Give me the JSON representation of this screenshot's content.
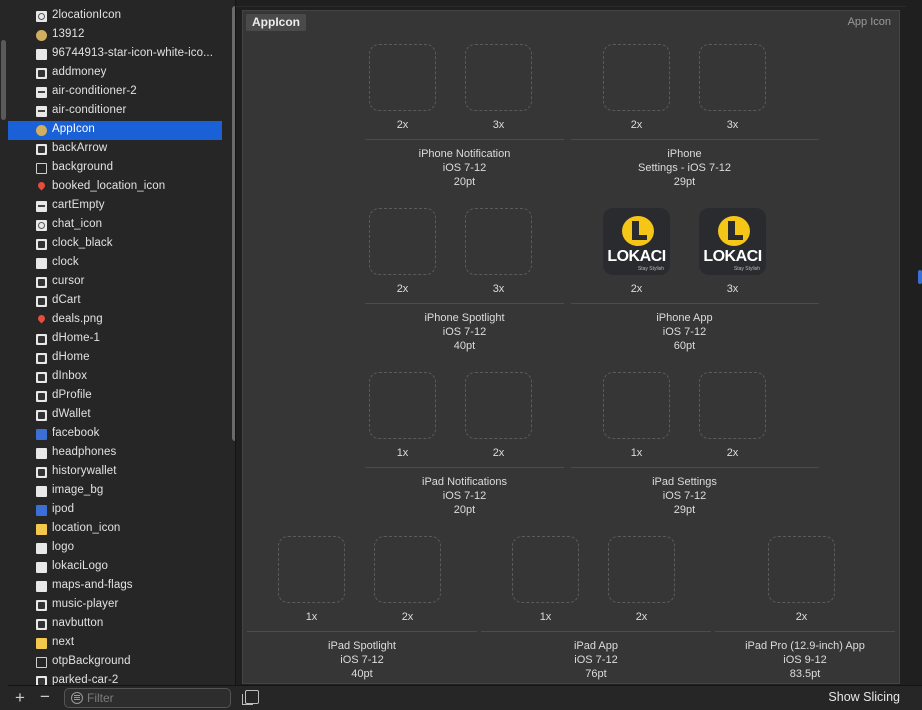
{
  "sidebar": {
    "items": [
      {
        "label": "2locationIcon",
        "icon": "image-icon",
        "style": "ring"
      },
      {
        "label": "13912",
        "icon": "image-icon",
        "style": "round"
      },
      {
        "label": "96744913-star-icon-white-ico...",
        "icon": "image-icon",
        "style": "plain"
      },
      {
        "label": "addmoney",
        "icon": "image-icon",
        "style": "dark"
      },
      {
        "label": "air-conditioner-2",
        "icon": "image-icon",
        "style": "line"
      },
      {
        "label": "air-conditioner",
        "icon": "image-icon",
        "style": "line"
      },
      {
        "label": "AppIcon",
        "icon": "app-icon-set-icon",
        "style": "round",
        "selected": true
      },
      {
        "label": "backArrow",
        "icon": "image-icon",
        "style": "dark"
      },
      {
        "label": "background",
        "icon": "image-icon",
        "style": "outline"
      },
      {
        "label": "booked_location_icon",
        "icon": "location-pin-icon",
        "style": "red"
      },
      {
        "label": "cartEmpty",
        "icon": "image-icon",
        "style": "line"
      },
      {
        "label": "chat_icon",
        "icon": "image-icon",
        "style": "ring"
      },
      {
        "label": "clock_black",
        "icon": "image-icon",
        "style": "dark"
      },
      {
        "label": "clock",
        "icon": "image-icon",
        "style": "plain"
      },
      {
        "label": "cursor",
        "icon": "image-icon",
        "style": "dark"
      },
      {
        "label": "dCart",
        "icon": "image-icon",
        "style": "dark"
      },
      {
        "label": "deals.png",
        "icon": "image-icon",
        "style": "red"
      },
      {
        "label": "dHome-1",
        "icon": "image-icon",
        "style": "dark"
      },
      {
        "label": "dHome",
        "icon": "image-icon",
        "style": "dark"
      },
      {
        "label": "dInbox",
        "icon": "image-icon",
        "style": "dark"
      },
      {
        "label": "dProfile",
        "icon": "image-icon",
        "style": "dark"
      },
      {
        "label": "dWallet",
        "icon": "image-icon",
        "style": "dark"
      },
      {
        "label": "facebook",
        "icon": "image-icon",
        "style": "blue"
      },
      {
        "label": "headphones",
        "icon": "image-icon",
        "style": "plain"
      },
      {
        "label": "historywallet",
        "icon": "image-icon",
        "style": "dark"
      },
      {
        "label": "image_bg",
        "icon": "image-icon",
        "style": "plain"
      },
      {
        "label": "ipod",
        "icon": "image-icon",
        "style": "blue"
      },
      {
        "label": "location_icon",
        "icon": "image-icon",
        "style": "yellow"
      },
      {
        "label": "logo",
        "icon": "image-icon",
        "style": "plain"
      },
      {
        "label": "lokaciLogo",
        "icon": "image-icon",
        "style": "plain"
      },
      {
        "label": "maps-and-flags",
        "icon": "image-icon",
        "style": "plain"
      },
      {
        "label": "music-player",
        "icon": "image-icon",
        "style": "dark"
      },
      {
        "label": "navbutton",
        "icon": "image-icon",
        "style": "dark"
      },
      {
        "label": "next",
        "icon": "image-icon",
        "style": "yellow"
      },
      {
        "label": "otpBackground",
        "icon": "image-icon",
        "style": "outline"
      },
      {
        "label": "parked-car-2",
        "icon": "image-icon",
        "style": "dark"
      }
    ]
  },
  "bottom_left": {
    "add": "+",
    "remove": "−",
    "filter_placeholder": "Filter"
  },
  "editor": {
    "set_name": "AppIcon",
    "set_type": "App Icon",
    "show_slicing": "Show Slicing",
    "groups": [
      {
        "name": "iPhone Notification",
        "line1": "iPhone Notification",
        "line2": "iOS 7-12",
        "line3": "20pt",
        "slots": [
          {
            "scale": "2x",
            "filled": false
          },
          {
            "scale": "3x",
            "filled": false
          }
        ]
      },
      {
        "name": "iPhone Settings",
        "line1": "iPhone",
        "line2": "Settings - iOS 7-12",
        "line3": "29pt",
        "slots": [
          {
            "scale": "2x",
            "filled": false
          },
          {
            "scale": "3x",
            "filled": false
          }
        ]
      },
      {
        "name": "iPhone Spotlight",
        "line1": "iPhone Spotlight",
        "line2": "iOS 7-12",
        "line3": "40pt",
        "slots": [
          {
            "scale": "2x",
            "filled": false
          },
          {
            "scale": "3x",
            "filled": false
          }
        ]
      },
      {
        "name": "iPhone App",
        "line1": "iPhone App",
        "line2": "iOS 7-12",
        "line3": "60pt",
        "slots": [
          {
            "scale": "2x",
            "filled": true
          },
          {
            "scale": "3x",
            "filled": true
          }
        ]
      },
      {
        "name": "iPad Notifications",
        "line1": "iPad Notifications",
        "line2": "iOS 7-12",
        "line3": "20pt",
        "slots": [
          {
            "scale": "1x",
            "filled": false
          },
          {
            "scale": "2x",
            "filled": false
          }
        ]
      },
      {
        "name": "iPad Settings",
        "line1": "iPad Settings",
        "line2": "iOS 7-12",
        "line3": "29pt",
        "slots": [
          {
            "scale": "1x",
            "filled": false
          },
          {
            "scale": "2x",
            "filled": false
          }
        ]
      },
      {
        "name": "iPad Spotlight",
        "line1": "iPad Spotlight",
        "line2": "iOS 7-12",
        "line3": "40pt",
        "slots": [
          {
            "scale": "1x",
            "filled": false
          },
          {
            "scale": "2x",
            "filled": false
          }
        ]
      },
      {
        "name": "iPad App",
        "line1": "iPad App",
        "line2": "iOS 7-12",
        "line3": "76pt",
        "slots": [
          {
            "scale": "1x",
            "filled": false
          },
          {
            "scale": "2x",
            "filled": false
          }
        ]
      },
      {
        "name": "iPad Pro App",
        "line1": "iPad Pro (12.9-inch) App",
        "line2": "iOS 9-12",
        "line3": "83.5pt",
        "slots": [
          {
            "scale": "2x",
            "filled": false
          }
        ]
      }
    ],
    "logo_text": "LOKACI",
    "logo_sub": "Stay Stylish"
  },
  "colors": {
    "selection": "#1a60d6",
    "logo_yellow": "#f5c518"
  }
}
